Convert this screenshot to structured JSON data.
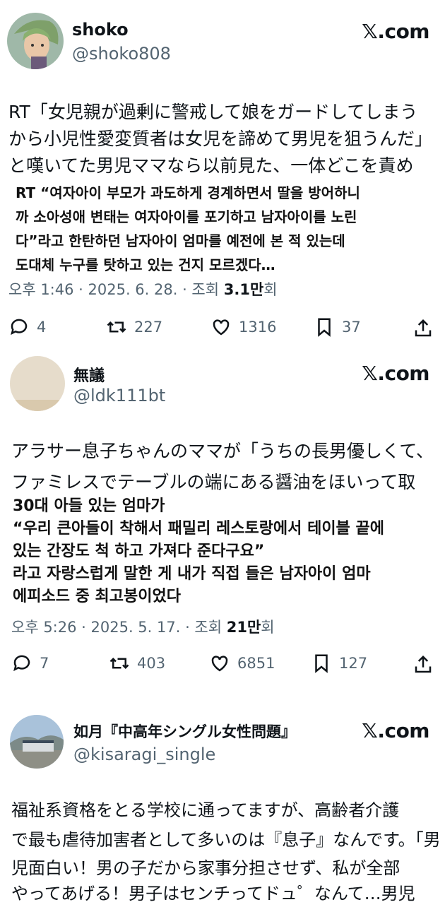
{
  "tweets": [
    {
      "name": "shoko",
      "handle": "@shoko808",
      "brand": "𝕏.com",
      "jp_lines": [
        "RT「女児親が過剰に警戒して娘をガードしてしまう",
        "から小児性愛変質者は女児を諦めて男児を狙うんだ」",
        "と嘆いてた男児ママなら以前見た、一体どこを責め"
      ],
      "ko_lines": [
        "RT “여자아이 부모가 과도하게 경계하면서 딸을 방어하니",
        "까 소아성애 변태는 여자아이를 포기하고 남자아이를 노린",
        "다”라고 한탄하던 남자아이 엄마를 예전에 본 적 있는데",
        "도대체 누구를 탓하고 있는 건지 모르겠다…"
      ],
      "meta_prefix": "오후 1:46 · 2025. 6. 28. · 조회 ",
      "views": "3.1만",
      "views_suffix": "회",
      "replies": "4",
      "reposts": "227",
      "likes": "1316",
      "bookmarks": "37"
    },
    {
      "name": "無議",
      "handle": "@ldk111bt",
      "brand": "𝕏.com",
      "jp_lines": [
        "アラサー息子ちゃんのママが「うちの長男優しくて、",
        "ファミレスでテーブルの端にある醤油をほいって取"
      ],
      "ko_lines": [
        "30대 아들 있는 엄마가",
        " “우리 큰아들이 착해서 패밀리 레스토랑에서 테이블 끝에",
        "있는 간장도 척 하고 가져다 준다구요”",
        "라고 자랑스럽게 말한 게 내가 직접 들은 남자아이 엄마",
        "에피소드 중 최고봉이었다"
      ],
      "meta_prefix": "오후 5:26 · 2025. 5. 17. · 조회 ",
      "views": "21만",
      "views_suffix": "회",
      "replies": "7",
      "reposts": "403",
      "likes": "6851",
      "bookmarks": "127"
    },
    {
      "name": "如月『中高年シングル女性問題』",
      "handle": "@kisaragi_single",
      "brand": "𝕏.com",
      "jp_lines": [
        "福祉系資格をとる学校に通ってますが、高齢者介護",
        "で最も虐待加害者として多いのは『息子』なんです。「男",
        "児面白い！男の子だから家事分担させず、私が全部",
        "やってあげる！男子はセンチってドュ゜なんて…男児"
      ]
    }
  ],
  "colors": {
    "text": "#0f1419",
    "muted": "#536471"
  },
  "icons": [
    "reply-icon",
    "repost-icon",
    "like-icon",
    "bookmark-icon",
    "share-icon"
  ]
}
